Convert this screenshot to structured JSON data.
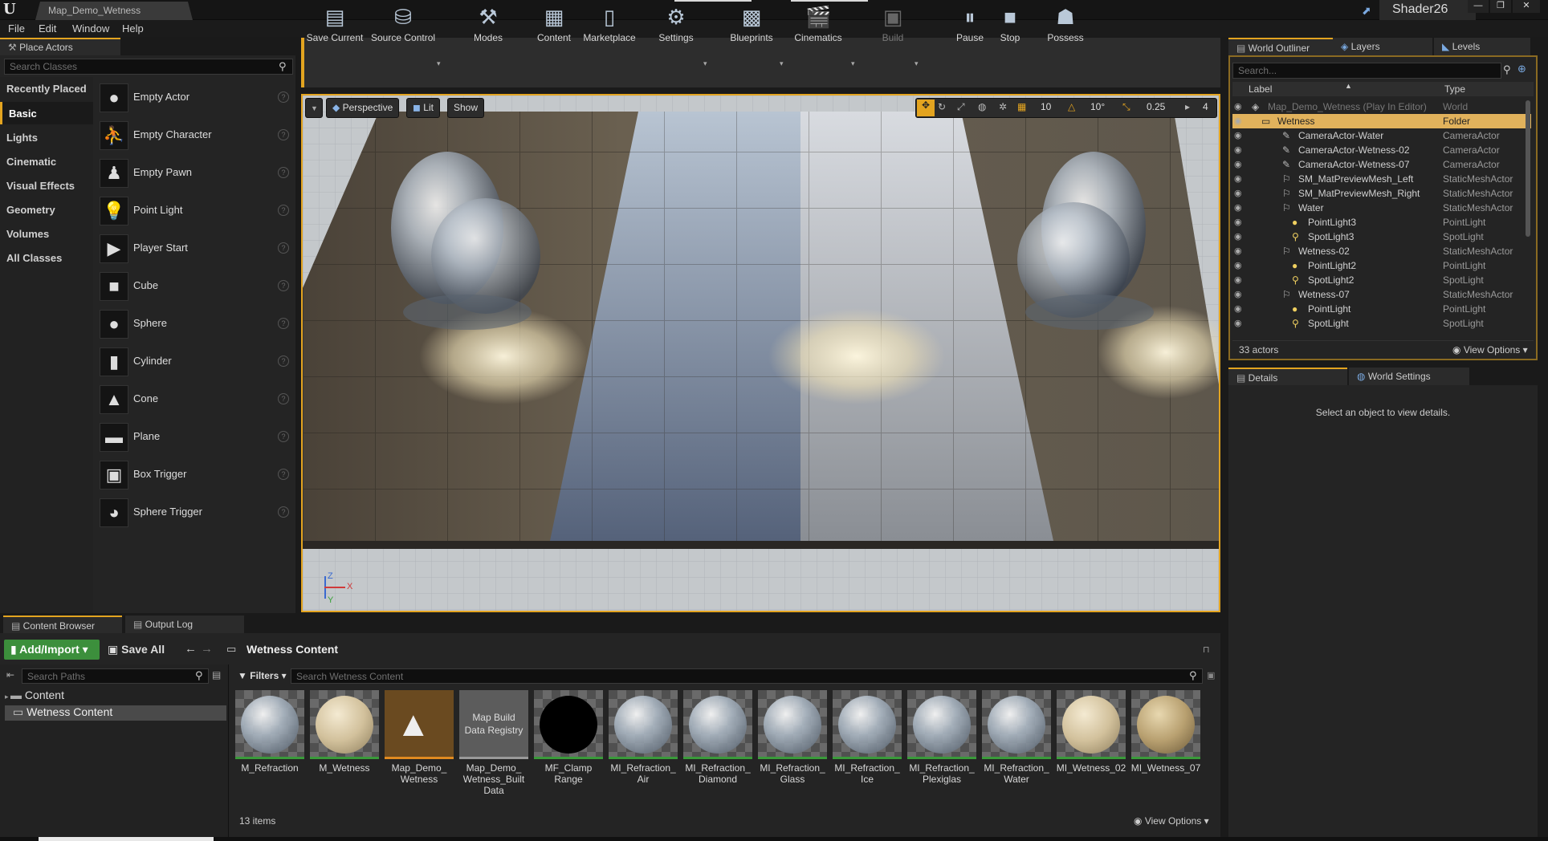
{
  "titlebar": {
    "tab": "Map_Demo_Wetness",
    "project": "Shader26",
    "controls": [
      "—",
      "❐",
      "✕"
    ]
  },
  "menu": [
    "File",
    "Edit",
    "Window",
    "Help"
  ],
  "place_actors": {
    "tab": "Place Actors",
    "search_placeholder": "Search Classes",
    "categories": [
      "Recently Placed",
      "Basic",
      "Lights",
      "Cinematic",
      "Visual Effects",
      "Geometry",
      "Volumes",
      "All Classes"
    ],
    "selected_category": "Basic",
    "actors": [
      "Empty Actor",
      "Empty Character",
      "Empty Pawn",
      "Point Light",
      "Player Start",
      "Cube",
      "Sphere",
      "Cylinder",
      "Cone",
      "Plane",
      "Box Trigger",
      "Sphere Trigger"
    ]
  },
  "toolbar": [
    {
      "label": "Save Current",
      "icon": "save-icon"
    },
    {
      "label": "Source Control",
      "icon": "source-control-icon"
    },
    {
      "label": "Modes",
      "icon": "modes-icon"
    },
    {
      "label": "Content",
      "icon": "content-icon"
    },
    {
      "label": "Marketplace",
      "icon": "marketplace-icon"
    },
    {
      "label": "Settings",
      "icon": "settings-icon"
    },
    {
      "label": "Blueprints",
      "icon": "blueprints-icon"
    },
    {
      "label": "Cinematics",
      "icon": "cinematics-icon"
    },
    {
      "label": "Build",
      "icon": "build-icon"
    },
    {
      "label": "Pause",
      "icon": "pause-icon"
    },
    {
      "label": "Stop",
      "icon": "stop-icon"
    },
    {
      "label": "Possess",
      "icon": "possess-icon"
    }
  ],
  "viewport": {
    "perspective": "Perspective",
    "lit": "Lit",
    "show": "Show",
    "grid_snap": "10",
    "rot_snap": "10°",
    "scale_snap": "0.25",
    "cam_speed": "4",
    "axis_z": "Z",
    "axis_x": "X",
    "axis_y": "Y"
  },
  "outliner": {
    "tabs": [
      "World Outliner",
      "Layers",
      "Levels"
    ],
    "search_placeholder": "Search...",
    "col_label": "Label",
    "col_type": "Type",
    "rows": [
      {
        "name": "Map_Demo_Wetness (Play In Editor)",
        "type": "World",
        "indent": 0,
        "dim": true
      },
      {
        "name": "Wetness",
        "type": "Folder",
        "indent": 1,
        "selected": true
      },
      {
        "name": "CameraActor-Water",
        "type": "CameraActor",
        "indent": 2
      },
      {
        "name": "CameraActor-Wetness-02",
        "type": "CameraActor",
        "indent": 2
      },
      {
        "name": "CameraActor-Wetness-07",
        "type": "CameraActor",
        "indent": 2
      },
      {
        "name": "SM_MatPreviewMesh_Left",
        "type": "StaticMeshActor",
        "indent": 2
      },
      {
        "name": "SM_MatPreviewMesh_Right",
        "type": "StaticMeshActor",
        "indent": 2
      },
      {
        "name": "Water",
        "type": "StaticMeshActor",
        "indent": 2
      },
      {
        "name": "PointLight3",
        "type": "PointLight",
        "indent": 3
      },
      {
        "name": "SpotLight3",
        "type": "SpotLight",
        "indent": 3
      },
      {
        "name": "Wetness-02",
        "type": "StaticMeshActor",
        "indent": 2
      },
      {
        "name": "PointLight2",
        "type": "PointLight",
        "indent": 3
      },
      {
        "name": "SpotLight2",
        "type": "SpotLight",
        "indent": 3
      },
      {
        "name": "Wetness-07",
        "type": "StaticMeshActor",
        "indent": 2
      },
      {
        "name": "PointLight",
        "type": "PointLight",
        "indent": 3
      },
      {
        "name": "SpotLight",
        "type": "SpotLight",
        "indent": 3
      }
    ],
    "count": "33 actors",
    "view_options": "View Options"
  },
  "details": {
    "tabs": [
      "Details",
      "World Settings"
    ],
    "empty_text": "Select an object to view details."
  },
  "content_browser": {
    "tabs": [
      "Content Browser",
      "Output Log"
    ],
    "add_import": "Add/Import",
    "save_all": "Save All",
    "path": "Wetness Content",
    "search_paths_placeholder": "Search Paths",
    "filters": "Filters",
    "search_placeholder": "Search Wetness Content",
    "tree": [
      "Content",
      "Wetness Content"
    ],
    "assets": [
      {
        "name": "M_Refraction",
        "kind": "glass"
      },
      {
        "name": "M_Wetness",
        "kind": "sand"
      },
      {
        "name": "Map_Demo_\nWetness",
        "kind": "map"
      },
      {
        "name": "Map_Demo_\nWetness_Built\nData",
        "kind": "registry",
        "thumb_text": "Map Build\nData Registry"
      },
      {
        "name": "MF_Clamp\nRange",
        "kind": "black"
      },
      {
        "name": "MI_Refraction_\nAir",
        "kind": "glass"
      },
      {
        "name": "MI_Refraction_\nDiamond",
        "kind": "glass"
      },
      {
        "name": "MI_Refraction_\nGlass",
        "kind": "glass"
      },
      {
        "name": "MI_Refraction_\nIce",
        "kind": "glass"
      },
      {
        "name": "MI_Refraction_\nPlexiglas",
        "kind": "glass"
      },
      {
        "name": "MI_Refraction_\nWater",
        "kind": "water"
      },
      {
        "name": "MI_Wetness_02",
        "kind": "sand"
      },
      {
        "name": "MI_Wetness_07",
        "kind": "sand2"
      }
    ],
    "item_count": "13 items",
    "view_options": "View Options"
  }
}
